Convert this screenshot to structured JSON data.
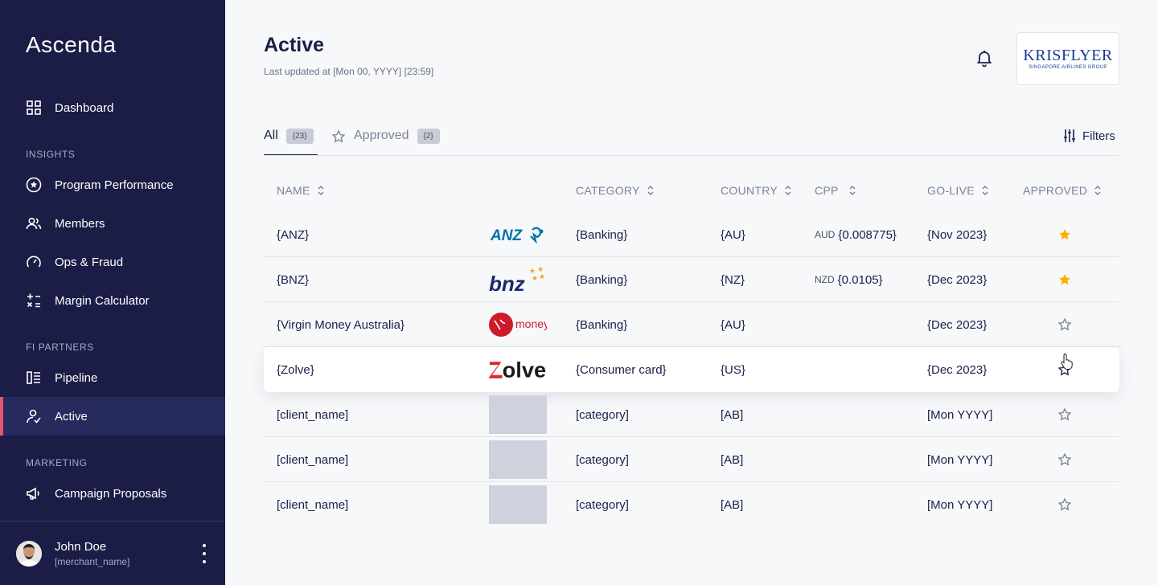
{
  "sidebar": {
    "brand": "Ascenda",
    "items": [
      {
        "label": "Dashboard",
        "icon": "grid-icon"
      },
      {
        "label": "Program Performance",
        "icon": "star-circle-icon"
      },
      {
        "label": "Members",
        "icon": "users-icon"
      },
      {
        "label": "Ops & Fraud",
        "icon": "gauge-icon"
      },
      {
        "label": "Margin Calculator",
        "icon": "calculator-icon"
      },
      {
        "label": "Pipeline",
        "icon": "pipeline-icon"
      },
      {
        "label": "Active",
        "icon": "user-check-icon"
      },
      {
        "label": "Campaign Proposals",
        "icon": "megaphone-icon"
      }
    ],
    "sections": {
      "insights": "INSIGHTS",
      "fi_partners": "FI PARTNERS",
      "marketing": "MARKETING"
    },
    "active_item": "Active",
    "user": {
      "name": "John Doe",
      "merchant": "[merchant_name]"
    }
  },
  "header": {
    "title": "Active",
    "updated": "Last updated at [Mon 00, YYYY] [23:59]",
    "partner_logo": {
      "main": "KRISFLYER",
      "sub": "SINGAPORE AIRLINES GROUP"
    }
  },
  "tabs": [
    {
      "label": "All",
      "count": "{23}",
      "selected": true
    },
    {
      "label": "Approved",
      "count": "{2}",
      "selected": false
    }
  ],
  "filters_label": "Filters",
  "table": {
    "columns": [
      "NAME",
      "CATEGORY",
      "COUNTRY",
      "CPP",
      "GO-LIVE",
      "APPROVED"
    ],
    "rows": [
      {
        "name": "{ANZ}",
        "logo": "ANZ",
        "category": "{Banking}",
        "country": "{AU}",
        "cpp_currency": "AUD",
        "cpp": "{0.008775}",
        "golive": "{Nov 2023}",
        "approved": true
      },
      {
        "name": "{BNZ}",
        "logo": "bnz",
        "category": "{Banking}",
        "country": "{NZ}",
        "cpp_currency": "NZD",
        "cpp": "{0.0105}",
        "golive": "{Dec 2023}",
        "approved": true
      },
      {
        "name": "{Virgin Money Australia}",
        "logo": "money",
        "category": "{Banking}",
        "country": "{AU}",
        "cpp_currency": "",
        "cpp": "",
        "golive": "{Dec 2023}",
        "approved": false
      },
      {
        "name": "{Zolve}",
        "logo": "Zolve",
        "category": "{Consumer card}",
        "country": "{US}",
        "cpp_currency": "",
        "cpp": "",
        "golive": "{Dec 2023}",
        "approved": false
      },
      {
        "name": "[client_name]",
        "logo": "",
        "category": "[category]",
        "country": "[AB]",
        "cpp_currency": "",
        "cpp": "",
        "golive": "[Mon YYYY]",
        "approved": false
      },
      {
        "name": "[client_name]",
        "logo": "",
        "category": "[category]",
        "country": "[AB]",
        "cpp_currency": "",
        "cpp": "",
        "golive": "[Mon YYYY]",
        "approved": false
      },
      {
        "name": "[client_name]",
        "logo": "",
        "category": "[category]",
        "country": "[AB]",
        "cpp_currency": "",
        "cpp": "",
        "golive": "[Mon YYYY]",
        "approved": false
      }
    ]
  },
  "colors": {
    "sidebar_bg": "#1b1d46",
    "active_indicator": "#e4566b",
    "star_filled": "#f5b400",
    "anz_blue": "#0072ac",
    "bnz_navy": "#1b2a6b",
    "virgin_red": "#cc1c2a",
    "zolve_red": "#e0242f"
  }
}
